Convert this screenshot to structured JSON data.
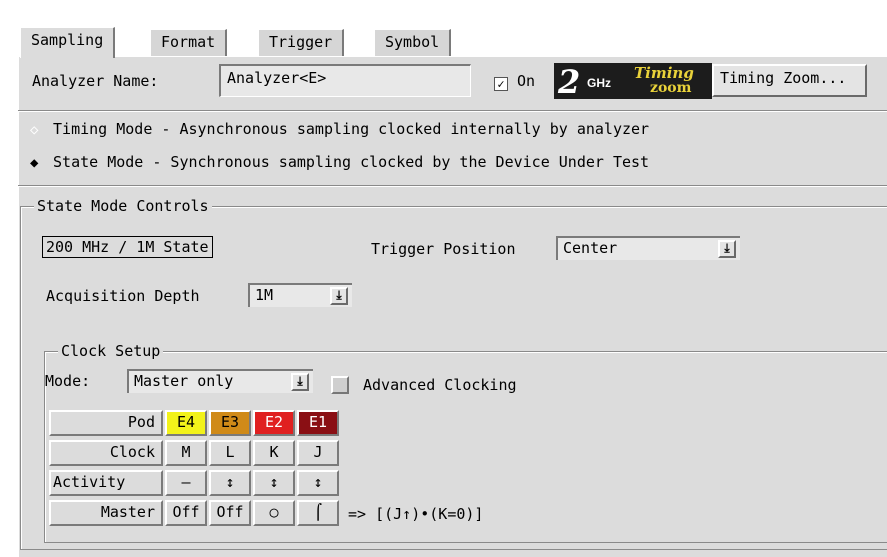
{
  "tabs": [
    {
      "label": "Sampling"
    },
    {
      "label": "Format"
    },
    {
      "label": "Trigger"
    },
    {
      "label": "Symbol"
    }
  ],
  "analyzer": {
    "name_label": "Analyzer Name:",
    "name_value": "Analyzer<E>",
    "on_check": "✓",
    "on_label": "On",
    "timing_zoom_button": "Timing Zoom..."
  },
  "logo": {
    "big": "2",
    "ghz": "GHz",
    "timing": "Timing",
    "zoom": "zoom"
  },
  "modes": {
    "timing": {
      "glyph": "◇",
      "label": "Timing Mode - Asynchronous sampling clocked internally by analyzer"
    },
    "state": {
      "glyph": "◆",
      "label": "State Mode  - Synchronous sampling clocked by the Device Under Test"
    }
  },
  "state_controls": {
    "legend": "State Mode Controls",
    "speed_button": "200 MHz / 1M State",
    "trigger_position_label": "Trigger Position",
    "trigger_position_value": "Center",
    "acq_depth_label": "Acquisition Depth",
    "acq_depth_value": "1M",
    "drop_glyph": "⤓"
  },
  "clock_setup": {
    "legend": "Clock Setup",
    "mode_label": "Mode:",
    "mode_value": "Master only",
    "advanced_label": "Advanced Clocking",
    "rows": {
      "pod": "Pod",
      "clock": "Clock",
      "activity": "Activity",
      "master": "Master"
    },
    "pods": [
      {
        "name": "E4",
        "bg": "#f2f21a",
        "fg": "#000000",
        "clock": "M",
        "activity": "–",
        "master": "Off"
      },
      {
        "name": "E3",
        "bg": "#d08a18",
        "fg": "#000000",
        "clock": "L",
        "activity": "↕",
        "master": "Off"
      },
      {
        "name": "E2",
        "bg": "#e02020",
        "fg": "#ffffff",
        "clock": "K",
        "activity": "↕",
        "master": "○"
      },
      {
        "name": "E1",
        "bg": "#8a0f14",
        "fg": "#ffffff",
        "clock": "J",
        "activity": "↕",
        "master": "⌠"
      }
    ],
    "expression": "=> [(J↑)•(K=0)]"
  },
  "colors": {
    "panel": "#dcdcdc",
    "logo_bg": "#1c1c1c",
    "logo_accent": "#e9d23a"
  }
}
